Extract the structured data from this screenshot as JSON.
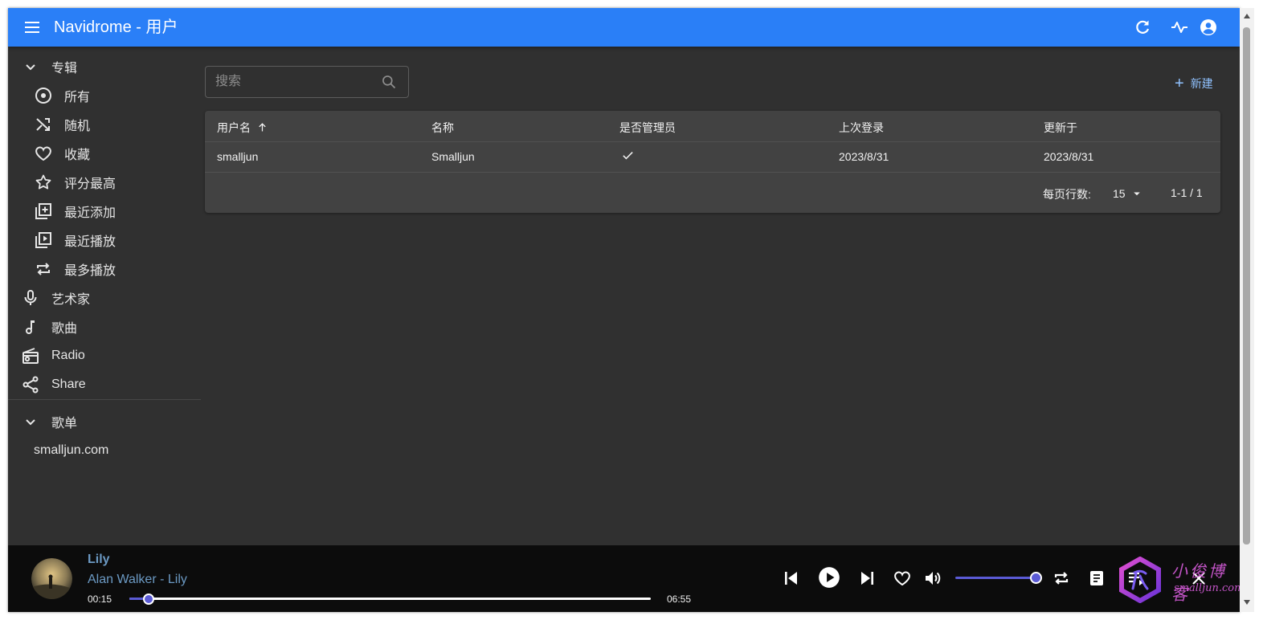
{
  "app": {
    "title": "Navidrome - 用户",
    "accent_color": "#2a7ff7"
  },
  "appbar_icons": [
    "refresh-icon",
    "activity-icon",
    "account-icon"
  ],
  "sidebar": {
    "albums_section": "专辑",
    "album_items": [
      {
        "label": "所有",
        "icon": "album-icon"
      },
      {
        "label": "随机",
        "icon": "shuffle-icon"
      },
      {
        "label": "收藏",
        "icon": "heart-icon"
      },
      {
        "label": "评分最高",
        "icon": "star-icon"
      },
      {
        "label": "最近添加",
        "icon": "library-add-icon"
      },
      {
        "label": "最近播放",
        "icon": "video-library-icon"
      },
      {
        "label": "最多播放",
        "icon": "repeat-icon"
      }
    ],
    "items": [
      {
        "label": "艺术家",
        "icon": "mic-icon"
      },
      {
        "label": "歌曲",
        "icon": "music-note-icon"
      },
      {
        "label": "Radio",
        "icon": "radio-icon"
      },
      {
        "label": "Share",
        "icon": "share-icon"
      }
    ],
    "playlists_section": "歌单",
    "playlists": [
      "smalljun.com"
    ]
  },
  "search": {
    "placeholder": "搜索"
  },
  "toolbar": {
    "create_label": "新建"
  },
  "table": {
    "columns": [
      "用户名",
      "名称",
      "是否管理员",
      "上次登录",
      "更新于"
    ],
    "sort_column": "用户名",
    "sort_direction": "asc",
    "rows": [
      {
        "username": "smalljun",
        "name": "Smalljun",
        "is_admin": true,
        "last_login": "2023/8/31",
        "updated": "2023/8/31"
      }
    ]
  },
  "pagination": {
    "rows_per_page_label": "每页行数:",
    "rows_per_page": "15",
    "range": "1-1 / 1"
  },
  "player": {
    "title": "Lily",
    "artist_line": "Alan Walker - Lily",
    "current_time": "00:15",
    "duration": "06:55",
    "progress_fraction": 0.036,
    "volume_fraction": 1.0
  },
  "watermark": {
    "text_cn": "小俊博客",
    "text_en": "smalljun.com"
  }
}
